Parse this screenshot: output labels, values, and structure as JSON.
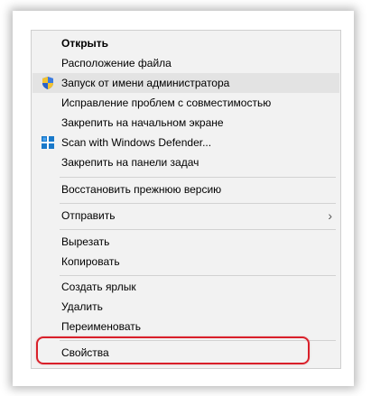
{
  "context_menu": {
    "items": [
      {
        "label": "Открыть",
        "bold": true
      },
      {
        "label": "Расположение файла"
      },
      {
        "label": "Запуск от имени администратора",
        "icon": "uac-shield-icon",
        "highlighted": true
      },
      {
        "label": "Исправление проблем с совместимостью"
      },
      {
        "label": "Закрепить на начальном экране"
      },
      {
        "label": "Scan with Windows Defender...",
        "icon": "windows-defender-icon"
      },
      {
        "label": "Закрепить на панели задач"
      },
      {
        "label": "Восстановить прежнюю версию"
      },
      {
        "label": "Отправить",
        "submenu": true,
        "icon": "chevron-right-icon"
      },
      {
        "label": "Вырезать"
      },
      {
        "label": "Копировать"
      },
      {
        "label": "Создать ярлык"
      },
      {
        "label": "Удалить"
      },
      {
        "label": "Переименовать"
      },
      {
        "label": "Свойства",
        "annotated": true
      }
    ],
    "submenu_arrow": "›"
  },
  "annotation": {
    "color": "#d9202a",
    "target": "Свойства"
  },
  "colors": {
    "menu_background": "#f2f2f2",
    "highlight": "#e3e3e3",
    "separator": "#d2d2d2"
  }
}
